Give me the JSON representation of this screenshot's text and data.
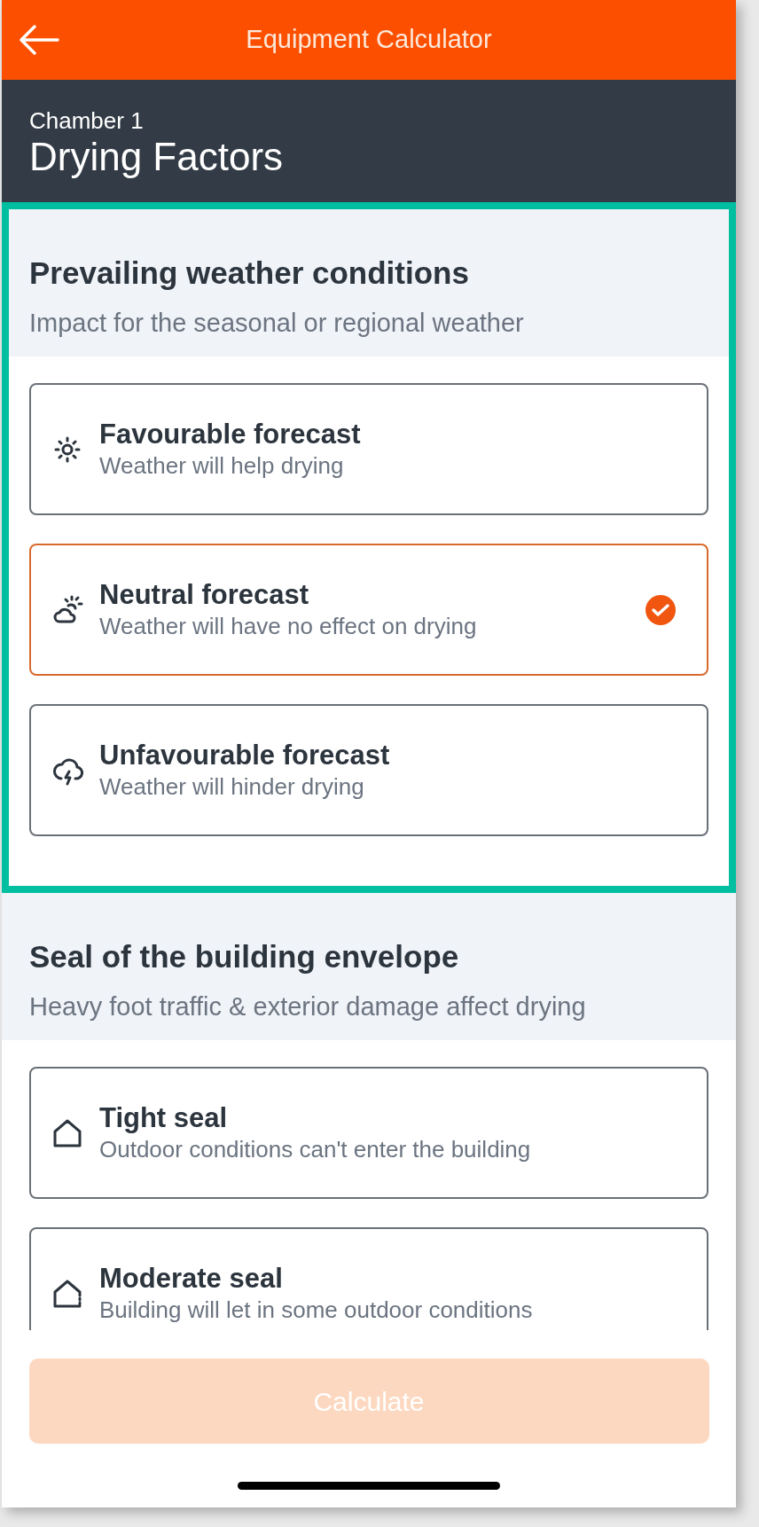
{
  "header": {
    "title": "Equipment Calculator"
  },
  "page": {
    "subtitle": "Chamber 1",
    "title": "Drying Factors"
  },
  "sections": [
    {
      "title": "Prevailing weather conditions",
      "description": "Impact for the seasonal or regional weather",
      "highlighted": true,
      "options": [
        {
          "kind": "sun",
          "title": "Favourable forecast",
          "description": "Weather will help drying",
          "selected": false
        },
        {
          "kind": "sun-cloud",
          "title": "Neutral forecast",
          "description": "Weather will have no effect on drying",
          "selected": true
        },
        {
          "kind": "storm",
          "title": "Unfavourable forecast",
          "description": "Weather will hinder drying",
          "selected": false
        }
      ]
    },
    {
      "title": "Seal of the building envelope",
      "description": "Heavy foot traffic & exterior damage affect drying",
      "highlighted": false,
      "options": [
        {
          "kind": "house",
          "title": "Tight seal",
          "description": "Outdoor conditions can't enter the building",
          "selected": false
        },
        {
          "kind": "house-open",
          "title": "Moderate seal",
          "description": "Building will let in some outdoor conditions",
          "selected": false
        }
      ]
    }
  ],
  "button": {
    "label": "Calculate",
    "disabled": true
  }
}
